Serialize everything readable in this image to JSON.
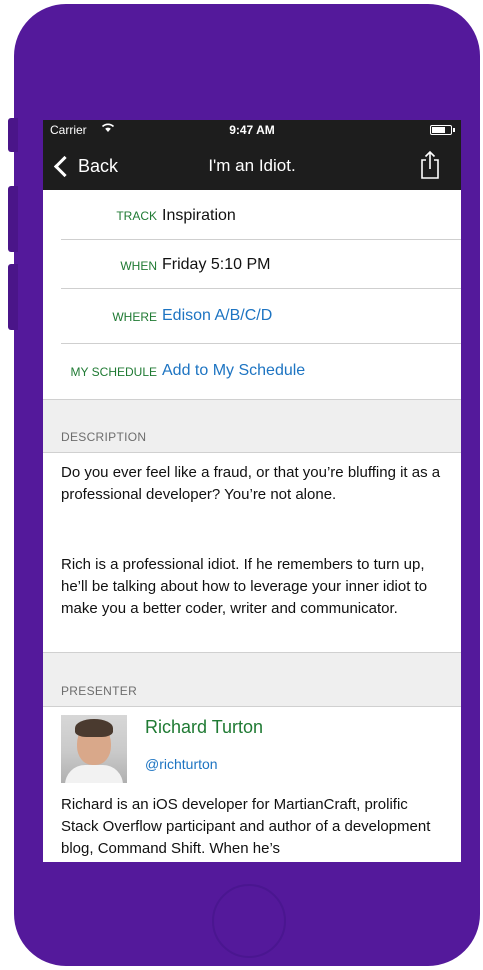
{
  "status_bar": {
    "carrier": "Carrier",
    "time": "9:47 AM",
    "battery_level": 0.7
  },
  "nav": {
    "back_label": "Back",
    "title": "I'm an Idiot."
  },
  "details": [
    {
      "label": "TRACK",
      "value": "Inspiration"
    },
    {
      "label": "WHEN",
      "value": "Friday 5:10 PM"
    },
    {
      "label": "WHERE",
      "value": "Edison A/B/C/D"
    },
    {
      "label": "MY SCHEDULE",
      "value": "Add to My Schedule"
    }
  ],
  "description": {
    "header": "DESCRIPTION",
    "paragraphs": [
      "Do you ever feel like a fraud, or that you’re bluffing it as a professional developer? You’re not alone.",
      "Rich is a professional idiot. If he remembers to turn up, he’ll be talking about how to leverage your inner idiot to make you a better coder, writer and communicator."
    ]
  },
  "presenter": {
    "header": "PRESENTER",
    "name": "Richard Turton",
    "handle": "@richturton",
    "bio": "Richard is an iOS developer for MartianCraft, prolific Stack Overflow participant and author of a development blog, Command Shift. When he’s"
  },
  "colors": {
    "frame": "#54199b",
    "accent_green": "#1f7a33",
    "link_blue": "#1d74c2",
    "navbar": "#1d1d1d"
  }
}
